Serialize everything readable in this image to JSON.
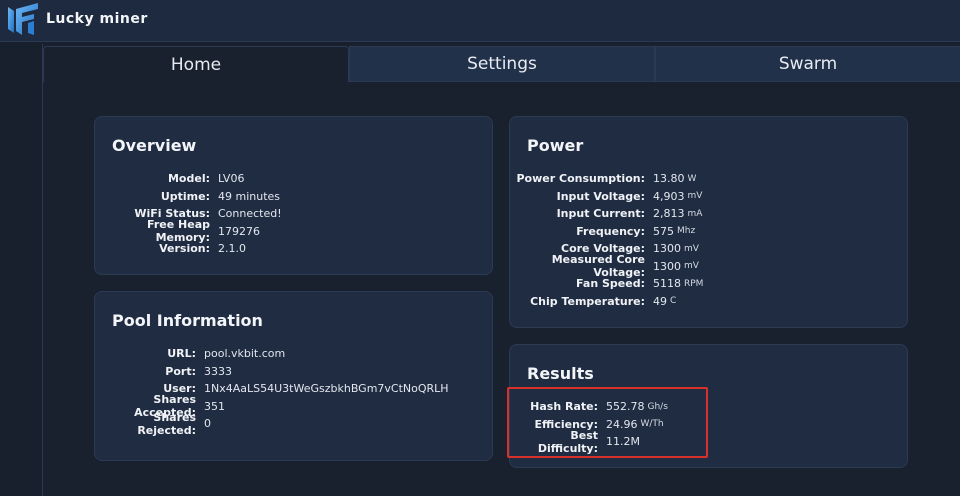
{
  "header": {
    "brand": "Lucky miner"
  },
  "tabs": [
    {
      "label": "Home",
      "active": true
    },
    {
      "label": "Settings"
    },
    {
      "label": "Swarm"
    }
  ],
  "overview": {
    "title": "Overview",
    "rows": [
      {
        "label": "Model:",
        "value": "LV06"
      },
      {
        "label": "Uptime:",
        "value": "49 minutes"
      },
      {
        "label": "WiFi Status:",
        "value": "Connected!"
      },
      {
        "label": "Free Heap Memory:",
        "value": "179276"
      },
      {
        "label": "Version:",
        "value": "2.1.0"
      }
    ]
  },
  "pool": {
    "title": "Pool Information",
    "rows": [
      {
        "label": "URL:",
        "value": "pool.vkbit.com"
      },
      {
        "label": "Port:",
        "value": "3333"
      },
      {
        "label": "User:",
        "value": "1Nx4AaLS54U3tWeGszbkhBGm7vCtNoQRLH"
      },
      {
        "label": "Shares Accepted:",
        "value": "351"
      },
      {
        "label": "Shares Rejected:",
        "value": "0"
      }
    ]
  },
  "power": {
    "title": "Power",
    "rows": [
      {
        "label": "Power Consumption:",
        "value": "13.80",
        "unit": "W"
      },
      {
        "label": "Input Voltage:",
        "value": "4,903",
        "unit": "mV"
      },
      {
        "label": "Input Current:",
        "value": "2,813",
        "unit": "mA"
      },
      {
        "label": "Frequency:",
        "value": "575",
        "unit": "Mhz"
      },
      {
        "label": "Core Voltage:",
        "value": "1300",
        "unit": "mV"
      },
      {
        "label": "Measured Core Voltage:",
        "value": "1300",
        "unit": "mV"
      },
      {
        "label": "Fan Speed:",
        "value": "5118",
        "unit": "RPM"
      },
      {
        "label": "Chip Temperature:",
        "value": "49",
        "unit": "C"
      }
    ]
  },
  "results": {
    "title": "Results",
    "rows": [
      {
        "label": "Hash Rate:",
        "value": "552.78",
        "unit": "Gh/s"
      },
      {
        "label": "Efficiency:",
        "value": "24.96",
        "unit": "W/Th"
      },
      {
        "label": "Best Difficulty:",
        "value": "11.2M"
      }
    ]
  },
  "colors": {
    "highlight": "#d9302c",
    "accent": "#2f8fe0"
  }
}
